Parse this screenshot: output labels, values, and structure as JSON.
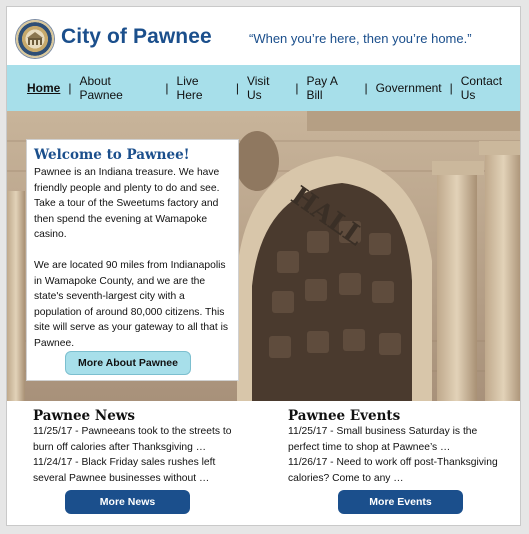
{
  "header": {
    "title": "City of Pawnee",
    "tagline": "“When you’re here, then you’re home.”",
    "logo_icon": "city-seal-icon"
  },
  "nav": {
    "items": [
      {
        "label": "Home",
        "active": true
      },
      {
        "label": "About Pawnee"
      },
      {
        "label": "Live Here"
      },
      {
        "label": "Visit Us"
      },
      {
        "label": "Pay A Bill"
      },
      {
        "label": "Government"
      },
      {
        "label": "Contact Us"
      }
    ],
    "separator": "|"
  },
  "hero": {
    "building_inscription": "HALL",
    "welcome": {
      "heading": "Welcome to Pawnee!",
      "paragraph1": "Pawnee is an Indiana treasure. We have friendly people and plenty to do and see. Take a tour of the Sweetums factory and then spend the evening at Wamapoke casino.",
      "paragraph2": "We are located 90 miles from Indianapolis in Wamapoke County, and we are the state's seventh-largest city with a population of around 80,000 citizens. This site will serve as your gateway to all that is Pawnee.",
      "button": "More About Pawnee"
    }
  },
  "news": {
    "heading": "Pawnee News",
    "items": [
      "11/25/17 - Pawneeans took to the streets to burn off calories after Thanksgiving …",
      "11/24/17 - Black Friday sales rushes left several Pawnee businesses without …"
    ],
    "button": "More News"
  },
  "events": {
    "heading": "Pawnee Events",
    "items": [
      "11/25/17 - Small business Saturday is the perfect time to shop at Pawnee’s …",
      "11/26/17 - Need to work off post-Thanksgiving calories? Come to any …"
    ],
    "button": "More Events"
  },
  "colors": {
    "brand_blue": "#1b4f8c",
    "nav_bg": "#a7dfea",
    "page_bg": "#e6e6e6"
  }
}
